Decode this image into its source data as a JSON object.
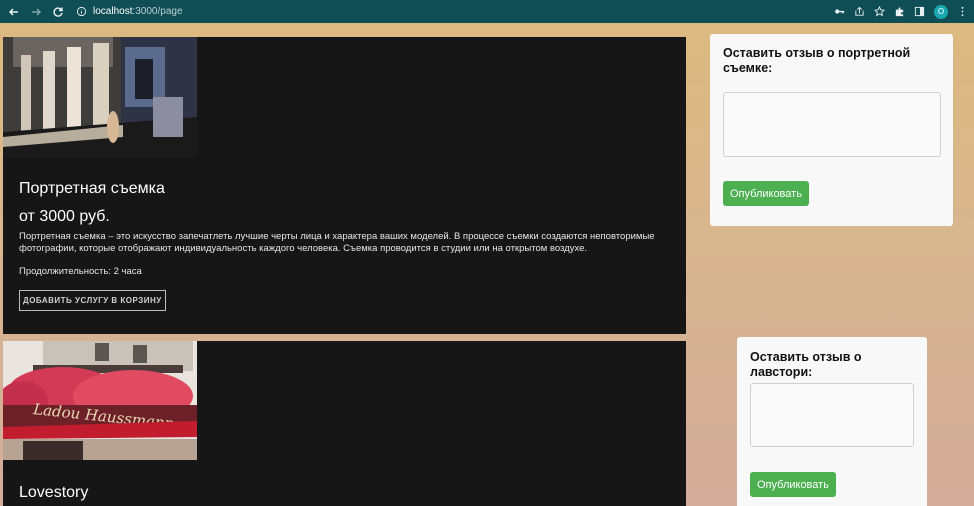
{
  "browser": {
    "url_host": "localhost",
    "url_path": ":3000/page",
    "profile_initial": "O"
  },
  "services": [
    {
      "title": "Портретная съемка",
      "price": "от 3000 руб.",
      "description": "Портретная съемка – это искусство запечатлеть лучшие черты лица и характера ваших моделей. В процессе съемки создаются неповторимые фотографии, которые отображают индивидуальность каждого человека. Съемка проводится в студии или на открытом воздухе.",
      "duration": "Продолжительность: 2 часа",
      "button_label": "ДОБАВИТЬ УСЛУГУ В КОРЗИНУ"
    },
    {
      "title": "Lovestory"
    }
  ],
  "reviews": [
    {
      "heading": "Оставить отзыв о портретной съемке:",
      "textarea_value": "",
      "button_label": "Опубликовать"
    },
    {
      "heading": "Оставить отзыв о лавстори:",
      "textarea_value": "",
      "button_label": "Опубликовать"
    }
  ],
  "colors": {
    "browser_bar": "#0f4e55",
    "card_bg": "#161616",
    "publish_button": "#4caf50"
  }
}
